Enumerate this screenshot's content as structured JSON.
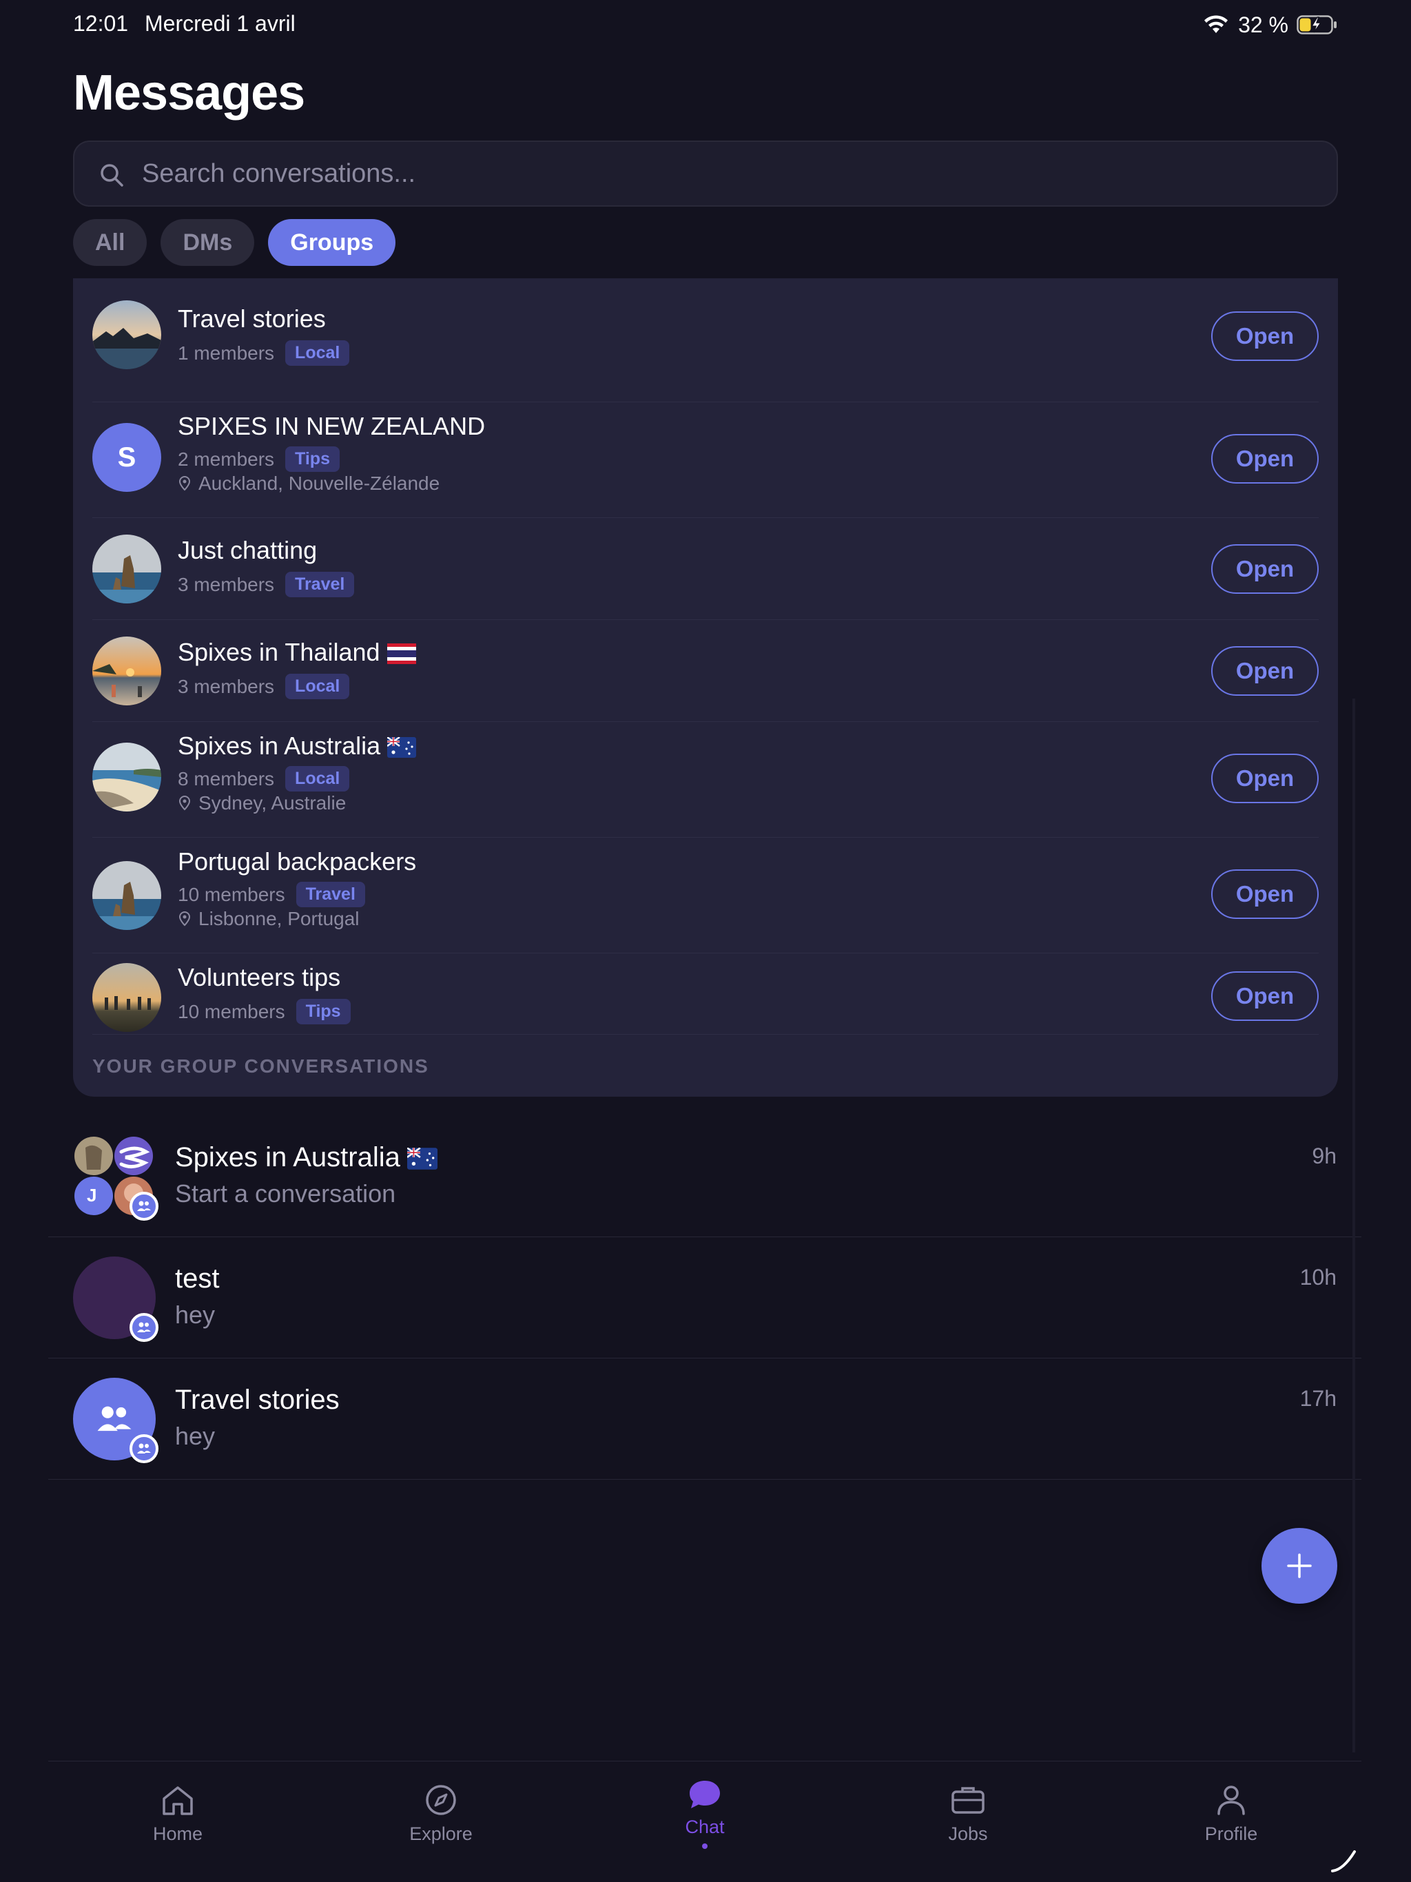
{
  "status_bar": {
    "time": "12:01",
    "date": "Mercredi 1 avril",
    "battery": "32 %"
  },
  "header": {
    "title": "Messages"
  },
  "search": {
    "placeholder": "Search conversations..."
  },
  "filters": [
    {
      "label": "All",
      "active": false
    },
    {
      "label": "DMs",
      "active": false
    },
    {
      "label": "Groups",
      "active": true
    }
  ],
  "groups": {
    "open_label": "Open",
    "items": [
      {
        "name": "Travel stories",
        "members": "1 members",
        "tag": "Local",
        "location": "",
        "avatar": "photo-sunset-pool"
      },
      {
        "name": "SPIXES IN NEW ZEALAND",
        "members": "2 members",
        "tag": "Tips",
        "location": "Auckland, Nouvelle-Zélande",
        "avatar": "letter",
        "avatar_letter": "S"
      },
      {
        "name": "Just chatting",
        "members": "3 members",
        "tag": "Travel",
        "location": "",
        "avatar": "photo-sea-rocks"
      },
      {
        "name": "Spixes in Thailand",
        "flag": "thailand-flag",
        "members": "3 members",
        "tag": "Local",
        "location": "",
        "avatar": "photo-beach-sunset"
      },
      {
        "name": "Spixes in Australia",
        "flag": "australia-flag",
        "members": "8 members",
        "tag": "Local",
        "location": "Sydney, Australie",
        "avatar": "photo-coast-beach"
      },
      {
        "name": "Portugal backpackers",
        "members": "10 members",
        "tag": "Travel",
        "location": "Lisbonne, Portugal",
        "avatar": "photo-sea-rocks"
      },
      {
        "name": "Volunteers tips",
        "members": "10 members",
        "tag": "Tips",
        "location": "",
        "avatar": "photo-group-sunset"
      }
    ],
    "section_label": "YOUR GROUP CONVERSATIONS"
  },
  "conversations": [
    {
      "name": "Spixes in Australia",
      "flag": "australia-flag",
      "preview": "Start a conversation",
      "time": "9h",
      "avatar": "mosaic",
      "mosaic_letter": "J"
    },
    {
      "name": "test",
      "preview": "hey",
      "time": "10h",
      "avatar": "plain-purple"
    },
    {
      "name": "Travel stories",
      "preview": "hey",
      "time": "17h",
      "avatar": "group-icon"
    }
  ],
  "tabbar": [
    {
      "label": "Home",
      "icon": "home-icon",
      "active": false
    },
    {
      "label": "Explore",
      "icon": "compass-icon",
      "active": false
    },
    {
      "label": "Chat",
      "icon": "chat-bubble-icon",
      "active": true
    },
    {
      "label": "Jobs",
      "icon": "briefcase-icon",
      "active": false
    },
    {
      "label": "Profile",
      "icon": "person-icon",
      "active": false
    }
  ],
  "colors": {
    "background": "#13121f",
    "panel": "#24233a",
    "accent": "#6a76e6",
    "active_tab": "#7c4ee4",
    "muted_text": "#8c8aa0"
  }
}
